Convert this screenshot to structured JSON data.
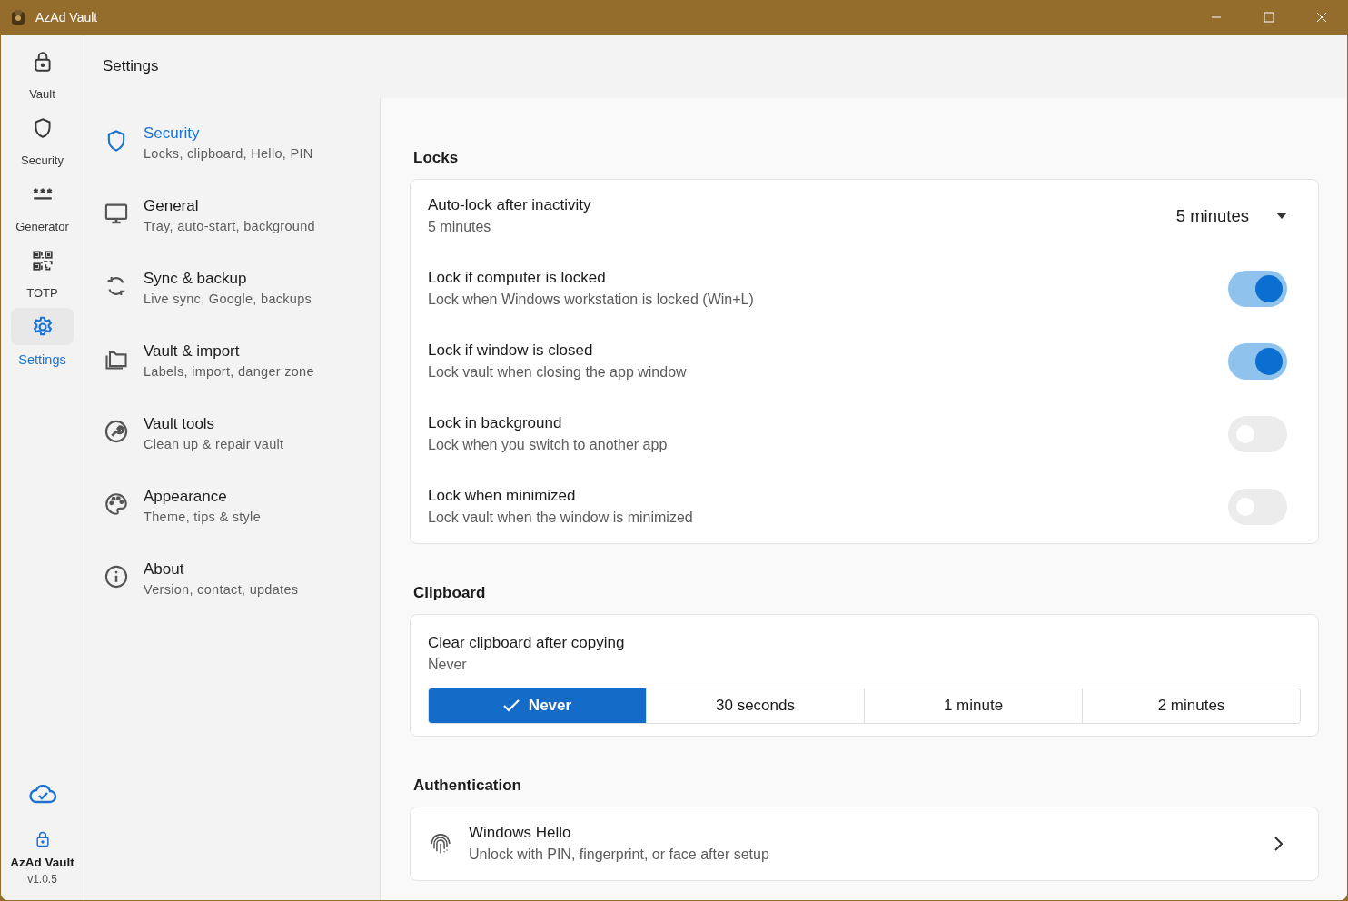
{
  "window": {
    "title": "AzAd Vault"
  },
  "rail": {
    "items": [
      {
        "label": "Vault",
        "selected": false
      },
      {
        "label": "Security",
        "selected": false
      },
      {
        "label": "Generator",
        "selected": false
      },
      {
        "label": "TOTP",
        "selected": false
      },
      {
        "label": "Settings",
        "selected": true
      }
    ],
    "footer": {
      "app_name": "AzAd Vault",
      "version": "v1.0.5"
    }
  },
  "header": {
    "title": "Settings"
  },
  "nav": {
    "items": [
      {
        "title": "Security",
        "subtitle": "Locks, clipboard, Hello, PIN",
        "selected": true
      },
      {
        "title": "General",
        "subtitle": "Tray, auto-start, background",
        "selected": false
      },
      {
        "title": "Sync & backup",
        "subtitle": "Live sync, Google, backups",
        "selected": false
      },
      {
        "title": "Vault & import",
        "subtitle": "Labels, import, danger zone",
        "selected": false
      },
      {
        "title": "Vault tools",
        "subtitle": "Clean up & repair vault",
        "selected": false
      },
      {
        "title": "Appearance",
        "subtitle": "Theme, tips & style",
        "selected": false
      },
      {
        "title": "About",
        "subtitle": "Version, contact, updates",
        "selected": false
      }
    ]
  },
  "sections": [
    {
      "title": "Locks",
      "rows": [
        {
          "kind": "dropdown",
          "title": "Auto-lock after inactivity",
          "subtitle": "5 minutes",
          "value": "5 minutes"
        },
        {
          "kind": "toggle",
          "title": "Lock if computer is locked",
          "subtitle": "Lock when Windows workstation is locked (Win+L)",
          "on": true
        },
        {
          "kind": "toggle",
          "title": "Lock if window is closed",
          "subtitle": "Lock vault when closing the app window",
          "on": true
        },
        {
          "kind": "toggle",
          "title": "Lock in background",
          "subtitle": "Lock when you switch to another app",
          "on": false
        },
        {
          "kind": "toggle",
          "title": "Lock when minimized",
          "subtitle": "Lock vault when the window is minimized",
          "on": false
        }
      ]
    },
    {
      "title": "Clipboard",
      "rows": [
        {
          "kind": "segmented",
          "title": "Clear clipboard after copying",
          "subtitle": "Never",
          "options": [
            {
              "label": "Never",
              "selected": true
            },
            {
              "label": "30 seconds",
              "selected": false
            },
            {
              "label": "1 minute",
              "selected": false
            },
            {
              "label": "2 minutes",
              "selected": false
            }
          ]
        }
      ]
    },
    {
      "title": "Authentication",
      "rows": [
        {
          "kind": "link",
          "title": "Windows Hello",
          "subtitle": "Unlock with PIN, fingerprint, or face after setup"
        }
      ]
    }
  ]
}
